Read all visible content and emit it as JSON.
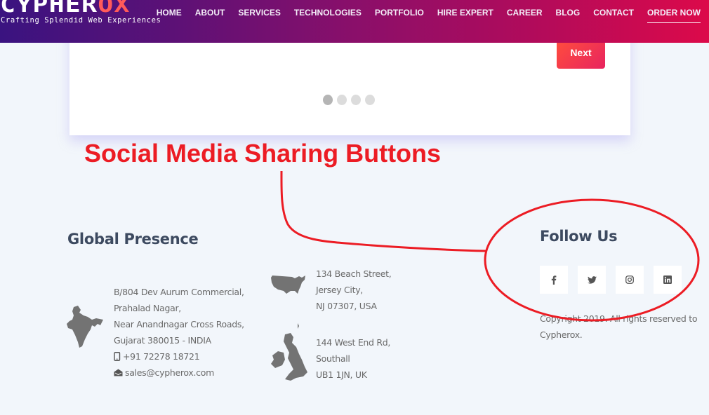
{
  "header": {
    "logo_main": "CYPHER",
    "logo_accent": "OX",
    "tagline": "Crafting Splendid Web Experiences",
    "nav": [
      {
        "label": "HOME"
      },
      {
        "label": "ABOUT"
      },
      {
        "label": "SERVICES"
      },
      {
        "label": "TECHNOLOGIES"
      },
      {
        "label": "PORTFOLIO"
      },
      {
        "label": "HIRE EXPERT"
      },
      {
        "label": "CAREER"
      },
      {
        "label": "BLOG"
      },
      {
        "label": "CONTACT"
      },
      {
        "label": "ORDER NOW",
        "active": true
      }
    ]
  },
  "carousel": {
    "next_label": "Next",
    "slides_total": 4,
    "active_slide": 1
  },
  "annotation": {
    "text": "Social Media Sharing Buttons",
    "color": "#ec1c24"
  },
  "global_presence": {
    "title": "Global Presence",
    "offices": [
      {
        "country_icon": "india-map-icon",
        "lines": [
          "B/804 Dev Aurum Commercial,",
          "Prahalad Nagar,",
          "Near Anandnagar Cross Roads,",
          "Gujarat 380015 - INDIA"
        ],
        "phone": "+91 72278 18721",
        "email": "sales@cypherox.com"
      },
      {
        "country_icon": "usa-map-icon",
        "lines": [
          "134 Beach Street,",
          "Jersey City,",
          "NJ 07307, USA"
        ]
      },
      {
        "country_icon": "uk-map-icon",
        "lines": [
          "144 West End Rd,",
          "Southall",
          "UB1 1JN, UK"
        ]
      }
    ]
  },
  "follow_us": {
    "title": "Follow Us",
    "social": [
      {
        "name": "facebook",
        "icon": "facebook-icon"
      },
      {
        "name": "twitter",
        "icon": "twitter-icon"
      },
      {
        "name": "instagram",
        "icon": "instagram-icon"
      },
      {
        "name": "linkedin",
        "icon": "linkedin-icon"
      }
    ],
    "copyright": "Copyright 2019. All rights reserved to Cypherox."
  },
  "colors": {
    "header_gradient_start": "#3a1380",
    "header_gradient_end": "#dc0a4a",
    "next_button": "#ff4d3d",
    "heading": "#3d4a60",
    "background": "#f2f6fb"
  }
}
